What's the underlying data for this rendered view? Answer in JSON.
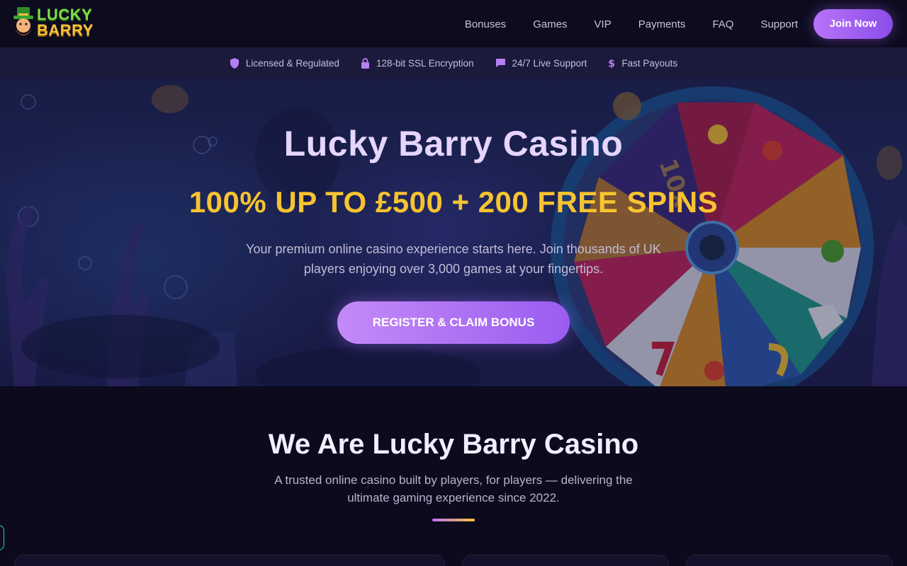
{
  "brand": {
    "logo_line1": "LUCKY",
    "logo_line2": "BARRY",
    "colors": {
      "accent": "#9a5cf0",
      "gold": "#f7c330",
      "green": "#7de04a"
    }
  },
  "nav": {
    "items": [
      {
        "label": "Bonuses"
      },
      {
        "label": "Games"
      },
      {
        "label": "VIP"
      },
      {
        "label": "Payments"
      },
      {
        "label": "FAQ"
      },
      {
        "label": "Support"
      }
    ],
    "join_label": "Join Now"
  },
  "trust": [
    {
      "icon": "shield-icon",
      "label": "Licensed & Regulated"
    },
    {
      "icon": "lock-icon",
      "label": "128-bit SSL Encryption"
    },
    {
      "icon": "chat-icon",
      "label": "24/7 Live Support"
    },
    {
      "icon": "dollar-icon",
      "label": "Fast Payouts"
    }
  ],
  "hero": {
    "title": "Lucky Barry Casino",
    "offer": "100% UP TO £500 + 200 FREE SPINS",
    "subtitle": "Your premium online casino experience starts here. Join thousands of UK players enjoying over 3,000 games at your fingertips.",
    "cta": "REGISTER & CLAIM BONUS",
    "wheel_label": "10x"
  },
  "about": {
    "title": "We Are Lucky Barry Casino",
    "subtitle": "A trusted online casino built by players, for players — delivering the ultimate gaming experience since 2022."
  }
}
